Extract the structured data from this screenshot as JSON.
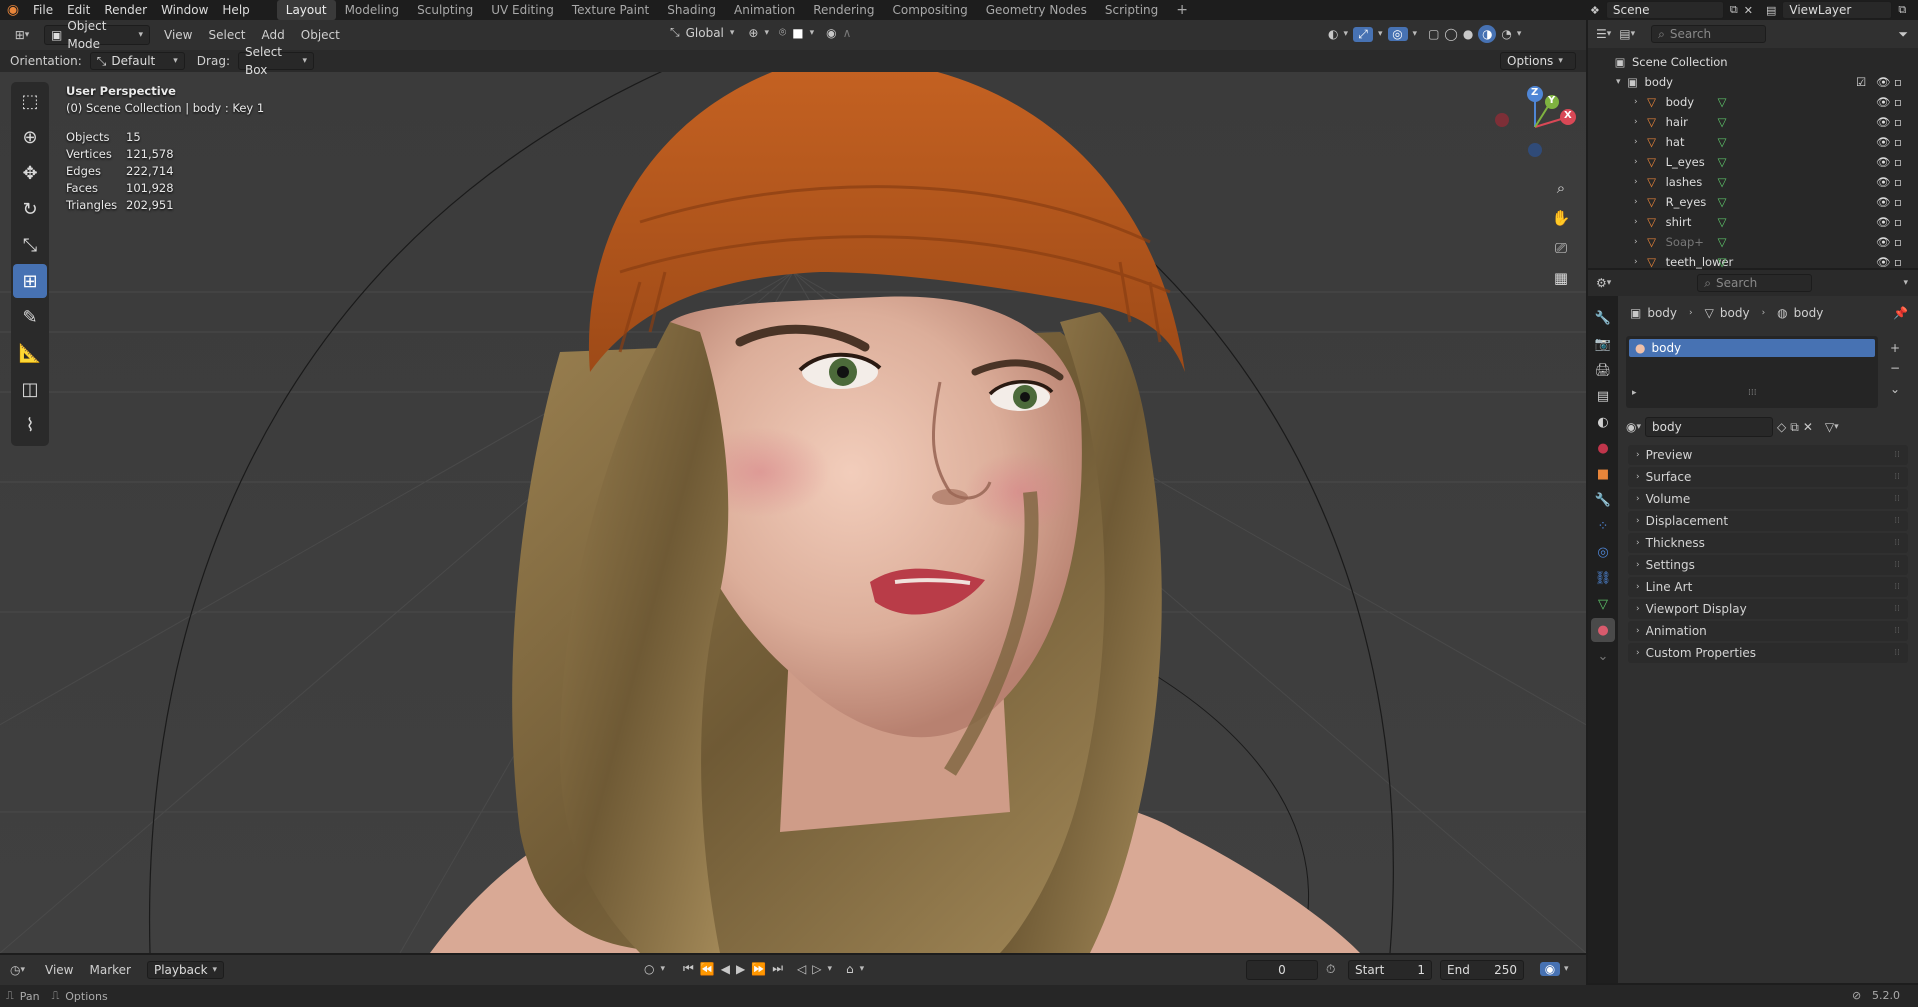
{
  "menu": {
    "items": [
      "File",
      "Edit",
      "Render",
      "Window",
      "Help"
    ]
  },
  "workspaces": [
    "Layout",
    "Modeling",
    "Sculpting",
    "UV Editing",
    "Texture Paint",
    "Shading",
    "Animation",
    "Rendering",
    "Compositing",
    "Geometry Nodes",
    "Scripting"
  ],
  "active_workspace": "Layout",
  "scene_name": "Scene",
  "view_layer": "ViewLayer",
  "viewport_header": {
    "mode": "Object Mode",
    "menus": [
      "View",
      "Select",
      "Add",
      "Object"
    ],
    "transform_orientation": "Global",
    "orientation_label": "Orientation:",
    "orientation_value": "Default",
    "drag_label": "Drag:",
    "drag_value": "Select Box",
    "options_label": "Options"
  },
  "overlay": {
    "view_name": "User Perspective",
    "context": "(0) Scene Collection | body : Key 1",
    "stats": [
      {
        "label": "Objects",
        "value": "15"
      },
      {
        "label": "Vertices",
        "value": "121,578"
      },
      {
        "label": "Edges",
        "value": "222,714"
      },
      {
        "label": "Faces",
        "value": "101,928"
      },
      {
        "label": "Triangles",
        "value": "202,951"
      }
    ]
  },
  "gizmo_axes": {
    "x": "X",
    "y": "Y",
    "z": "Z"
  },
  "outliner": {
    "search_placeholder": "Search",
    "root": "Scene Collection",
    "collection": "body",
    "objects": [
      "body",
      "hair",
      "hat",
      "L_eyes",
      "lashes",
      "R_eyes",
      "shirt",
      "Soap+",
      "teeth_lower"
    ]
  },
  "properties": {
    "search_placeholder": "Search",
    "breadcrumb": [
      "body",
      "body",
      "body"
    ],
    "material_slot": "body",
    "material_name": "body",
    "panels": [
      "Preview",
      "Surface",
      "Volume",
      "Displacement",
      "Thickness",
      "Settings",
      "Line Art",
      "Viewport Display",
      "Animation",
      "Custom Properties"
    ]
  },
  "timeline": {
    "menus": [
      "View",
      "Marker"
    ],
    "playback_label": "Playback",
    "current_frame": "0",
    "start_label": "Start",
    "start_value": "1",
    "end_label": "End",
    "end_value": "250"
  },
  "statusbar": {
    "left_items": [
      "Pan",
      "Options"
    ],
    "version": "5.2.0"
  },
  "colors": {
    "accent": "#4772b3",
    "hat": "#b4561d",
    "hair": "#8a7142",
    "skin": "#e4b8a4",
    "lips": "#b93c48",
    "grid": "#3d3d3d"
  }
}
